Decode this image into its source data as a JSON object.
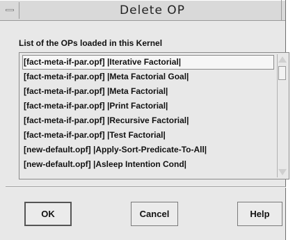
{
  "window": {
    "title": "Delete OP"
  },
  "list": {
    "label": "List of the OPs loaded in this Kernel",
    "items": [
      "[fact-meta-if-par.opf] |Iterative Factorial|",
      "[fact-meta-if-par.opf] |Meta Factorial Goal|",
      "[fact-meta-if-par.opf] |Meta Factorial|",
      "[fact-meta-if-par.opf] |Print Factorial|",
      "[fact-meta-if-par.opf] |Recursive Factorial|",
      "[fact-meta-if-par.opf] |Test Factorial|",
      "[new-default.opf] |Apply-Sort-Predicate-To-All|",
      "[new-default.opf] |Asleep Intention Cond|"
    ],
    "selected_index": 0
  },
  "buttons": {
    "ok": "OK",
    "cancel": "Cancel",
    "help": "Help"
  },
  "icons": {
    "window_menu": "window-menu-icon",
    "scroll_up": "scroll-up-arrow-icon",
    "scroll_down": "scroll-down-arrow-icon"
  },
  "colors": {
    "background": "#e8e8e8",
    "border": "#8a8a8a",
    "text": "#111111"
  }
}
